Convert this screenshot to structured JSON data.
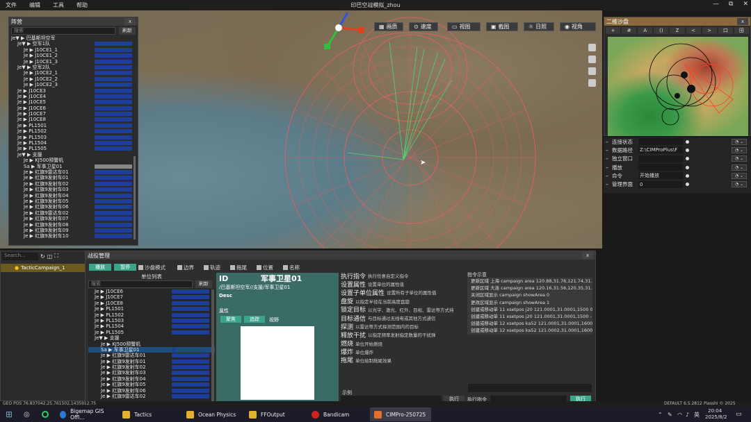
{
  "menu": [
    "文件",
    "编辑",
    "工具",
    "帮助"
  ],
  "window_title": "印巴空战模拟_zhou",
  "win_controls": [
    "—",
    "⧉",
    "✕"
  ],
  "view_buttons": [
    "画质",
    "速度",
    "视图",
    "截图",
    "日照",
    "视角"
  ],
  "order_panel": {
    "title": "阵营",
    "close": "x",
    "search_placeholder": "搜索",
    "refresh": "刷新",
    "rows": [
      {
        "t": "Je▼ ▶ 巴基斯坦空军",
        "i": 0,
        "bar": false
      },
      {
        "t": "Je▼ ▶ 空军1队",
        "i": 1,
        "bar": true
      },
      {
        "t": "Je ▶ J10CE1_1",
        "i": 2,
        "bar": true
      },
      {
        "t": "Je ▶ J10CE1_2",
        "i": 2,
        "bar": true
      },
      {
        "t": "Je ▶ J10CE1_3",
        "i": 2,
        "bar": true
      },
      {
        "t": "Je▼ ▶ 空军2队",
        "i": 1,
        "bar": true
      },
      {
        "t": "Je ▶ J10CE2_1",
        "i": 2,
        "bar": true
      },
      {
        "t": "Je ▶ J10CE2_2",
        "i": 2,
        "bar": true
      },
      {
        "t": "Je ▶ J10CE2_3",
        "i": 2,
        "bar": true
      },
      {
        "t": "Je ▶ J10CE3",
        "i": 1,
        "bar": true
      },
      {
        "t": "Je ▶ J10CE4",
        "i": 1,
        "bar": true
      },
      {
        "t": "Je ▶ J10CE5",
        "i": 1,
        "bar": true
      },
      {
        "t": "Je ▶ J10CE6",
        "i": 1,
        "bar": true
      },
      {
        "t": "Je ▶ J10CE7",
        "i": 1,
        "bar": true
      },
      {
        "t": "Je ▶ J10CE8",
        "i": 1,
        "bar": true
      },
      {
        "t": "Je ▶ PL1501",
        "i": 1,
        "bar": true
      },
      {
        "t": "Je ▶ PL1502",
        "i": 1,
        "bar": true
      },
      {
        "t": "Je ▶ PL1503",
        "i": 1,
        "bar": true
      },
      {
        "t": "Je ▶ PL1504",
        "i": 1,
        "bar": true
      },
      {
        "t": "Je ▶ PL1505",
        "i": 1,
        "bar": true
      },
      {
        "t": "Je▼ ▶ 支援",
        "i": 1,
        "bar": false
      },
      {
        "t": "Je ▶ KJ500预警机",
        "i": 2,
        "bar": false
      },
      {
        "t": "Sa ▶ 军事卫星01",
        "i": 2,
        "bar": "grey"
      },
      {
        "t": "Je ▶ 红旗9雷达车01",
        "i": 2,
        "bar": true
      },
      {
        "t": "Je ▶ 红旗9发射车01",
        "i": 2,
        "bar": true
      },
      {
        "t": "Je ▶ 红旗9发射车02",
        "i": 2,
        "bar": true
      },
      {
        "t": "Je ▶ 红旗9发射车03",
        "i": 2,
        "bar": true
      },
      {
        "t": "Je ▶ 红旗9发射车04",
        "i": 2,
        "bar": true
      },
      {
        "t": "Je ▶ 红旗9发射车05",
        "i": 2,
        "bar": true
      },
      {
        "t": "Je ▶ 红旗9发射车06",
        "i": 2,
        "bar": true
      },
      {
        "t": "Je ▶ 红旗9雷达车02",
        "i": 2,
        "bar": true
      },
      {
        "t": "Je ▶ 红旗9发射车07",
        "i": 2,
        "bar": true
      },
      {
        "t": "Je ▶ 红旗9发射车08",
        "i": 2,
        "bar": true
      },
      {
        "t": "Je ▶ 红旗9发射车09",
        "i": 2,
        "bar": true
      },
      {
        "t": "Je ▶ 红旗9发射车10",
        "i": 2,
        "bar": true
      }
    ]
  },
  "minimap": {
    "title": "二维沙盘",
    "close": "x",
    "tools": [
      "+",
      "#",
      "A",
      "()",
      "Z",
      "<",
      ">",
      "口",
      "田"
    ]
  },
  "props": [
    {
      "k": "连接状态",
      "v": ""
    },
    {
      "k": "数据路径",
      "v": "Z:\\CIMProPlus\\F"
    },
    {
      "k": "独立窗口",
      "v": ""
    },
    {
      "k": "播放",
      "v": ""
    },
    {
      "k": "命令",
      "v": "开始播放"
    },
    {
      "k": "管理界面",
      "v": "0"
    }
  ],
  "campaign": {
    "search_placeholder": "Search...",
    "item": "TacticCampaign_1"
  },
  "battle": {
    "title": "战役管理",
    "close": "x",
    "play": "播放",
    "pause": "暂停",
    "checks": [
      "沙盘模式",
      "边界",
      "轨迹",
      "拖尾",
      "位置",
      "名称"
    ],
    "unit_list_title": "单位列表",
    "search_placeholder": "搜索",
    "refresh": "刷新",
    "units": [
      {
        "t": "Je ▶ J10CE6",
        "i": 1,
        "bar": true
      },
      {
        "t": "Je ▶ J10CE7",
        "i": 1,
        "bar": true
      },
      {
        "t": "Je ▶ J10CE8",
        "i": 1,
        "bar": true
      },
      {
        "t": "Je ▶ PL1501",
        "i": 1,
        "bar": true
      },
      {
        "t": "Je ▶ PL1502",
        "i": 1,
        "bar": true
      },
      {
        "t": "Je ▶ PL1503",
        "i": 1,
        "bar": true
      },
      {
        "t": "Je ▶ PL1504",
        "i": 1,
        "bar": true
      },
      {
        "t": "Je ▶ PL1505",
        "i": 1,
        "bar": true
      },
      {
        "t": "Je▼ ▶ 支援",
        "i": 1,
        "bar": false
      },
      {
        "t": "Je ▶ KJ500预警机",
        "i": 2,
        "bar": false
      },
      {
        "t": "Sa ▶ 军事卫星01",
        "i": 2,
        "bar": "small",
        "sel": true
      },
      {
        "t": "Je ▶ 红旗9雷达车01",
        "i": 2,
        "bar": true
      },
      {
        "t": "Je ▶ 红旗9发射车01",
        "i": 2,
        "bar": true
      },
      {
        "t": "Je ▶ 红旗9发射车02",
        "i": 2,
        "bar": true
      },
      {
        "t": "Je ▶ 红旗9发射车03",
        "i": 2,
        "bar": true
      },
      {
        "t": "Je ▶ 红旗9发射车04",
        "i": 2,
        "bar": true
      },
      {
        "t": "Je ▶ 红旗9发射车05",
        "i": 2,
        "bar": true
      },
      {
        "t": "Je ▶ 红旗9发射车06",
        "i": 2,
        "bar": true
      },
      {
        "t": "Je ▶ 红旗9雷达车02",
        "i": 2,
        "bar": true
      }
    ],
    "detail": {
      "id_label": "ID",
      "name": "军事卫星01",
      "path": "/巴基斯坦空军//支援/军事卫星01",
      "desc": "Desc",
      "attr": "属性",
      "buttons": [
        "聚焦",
        "追踪"
      ],
      "view": "视野"
    },
    "commands": [
      {
        "c": "执行指令",
        "d": "执行任意自定义指令"
      },
      {
        "c": "设置属性",
        "d": "设置单位的属性值"
      },
      {
        "c": "设置子单位属性",
        "d": "设置所有子单位的属性值"
      },
      {
        "c": "盘旋",
        "d": "以指定半径在当前高度盘旋"
      },
      {
        "c": "锁定目标",
        "d": "以光学、激光、红外、目视、雷达等方式持"
      },
      {
        "c": "目标通信",
        "d": "与目标通过无线电或其他方式通信"
      },
      {
        "c": "探测",
        "d": "以雷达等方式探测范围内的目标"
      },
      {
        "c": "释放干扰",
        "d": "以指定频率发射指定数量的干扰弹"
      },
      {
        "c": "燃烧",
        "d": "单位开始燃烧"
      },
      {
        "c": "爆炸",
        "d": "单位爆炸"
      },
      {
        "c": "拖尾",
        "d": "单位绘制拖尾效果"
      }
    ],
    "example_title": "指令示意",
    "examples": [
      "更新区域 上海 campaign area 120.88,31.76,121.74,31.2",
      "更新区域 大连 campaign area 120.16,31.56,120.35,31.2",
      "关闭区域显示 campaign showArea 0",
      "更改区域显示 campaign showArea 1",
      "创建或移动单 11 xsetpos j20 121.0001,31.0001,1500 0,",
      "创建或移动单 11 xsetpos j20 121.0001,31.0001,1500 -",
      "创建或移动单 12 xsetpos ka52 121.0001,31.0001,1600",
      "创建或移动单 12 xsetpos ka52 121.0002,31.0001,1600"
    ],
    "example_label": "示例",
    "exec": "执行",
    "exec_cmd_label": "执行指令",
    "exec2": "执行"
  },
  "status": {
    "left": "GEO POS 76.837042,25.761502,1435912.75",
    "right_items": [
      "DEFAULT",
      "6.5.2812",
      "Piasshi © 2025"
    ]
  },
  "taskbar": {
    "apps": [
      "Bigemap GIS Offl...",
      "Tactics",
      "Ocean Physics",
      "FFOutput",
      "Bandicam",
      "CIMPro-250725"
    ],
    "tray_lang": "英",
    "time": "20:04",
    "date": "2025/8/2"
  },
  "colors": {
    "accent": "#3aa58a",
    "bar": "#1d3f9a",
    "detail": "#3a6b64",
    "ring": "#e05050"
  }
}
